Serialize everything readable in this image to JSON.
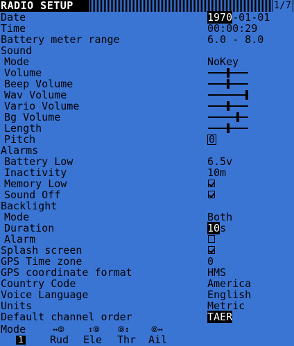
{
  "title": "RADIO SETUP",
  "page": "1/7",
  "rows": {
    "date_label": "Date",
    "date_year": "1970",
    "date_rest": "-01-01",
    "time_label": "Time",
    "time_value": "00:00:29",
    "battery_range_label": "Battery meter range",
    "battery_range_value": "6.0 - 8.0",
    "sound_label": "Sound",
    "sound_mode_label": "Mode",
    "sound_mode_value": "NoKey",
    "volume_label": "Volume",
    "beep_volume_label": "Beep Volume",
    "wav_volume_label": "Wav Volume",
    "vario_volume_label": "Vario Volume",
    "bg_volume_label": "Bg Volume",
    "length_label": "Length",
    "pitch_label": "Pitch",
    "pitch_value": "0",
    "alarms_label": "Alarms",
    "battery_low_label": "Battery Low",
    "battery_low_value": "6.5v",
    "inactivity_label": "Inactivity",
    "inactivity_value": "10m",
    "memory_low_label": "Memory Low",
    "sound_off_label": "Sound Off",
    "backlight_label": "Backlight",
    "backlight_mode_label": "Mode",
    "backlight_mode_value": "Both",
    "duration_label": "Duration",
    "duration_value_num": "10",
    "duration_value_unit": "s",
    "alarm_label": "Alarm",
    "splash_label": "Splash screen",
    "gps_tz_label": "GPS Time zone",
    "gps_tz_value": "0",
    "gps_coord_label": "GPS coordinate format",
    "gps_coord_value": "HMS",
    "country_label": "Country Code",
    "country_value": "America",
    "voice_lang_label": "Voice Language",
    "voice_lang_value": "English",
    "units_label": "Units",
    "units_value": "Metric",
    "channel_order_label": "Default channel order",
    "channel_order_value": "TAER",
    "mode_label": "Mode",
    "mode_value": "1",
    "stick_rud": "Rud",
    "stick_ele": "Ele",
    "stick_thr": "Thr",
    "stick_ail": "Ail"
  },
  "sliders": {
    "volume": 0.5,
    "beep_volume": 0.5,
    "wav_volume": 1.0,
    "vario_volume": 0.5,
    "bg_volume": 0.75,
    "length": 0.5
  },
  "checks": {
    "memory_low": true,
    "sound_off": true,
    "alarm": false,
    "splash": true
  }
}
